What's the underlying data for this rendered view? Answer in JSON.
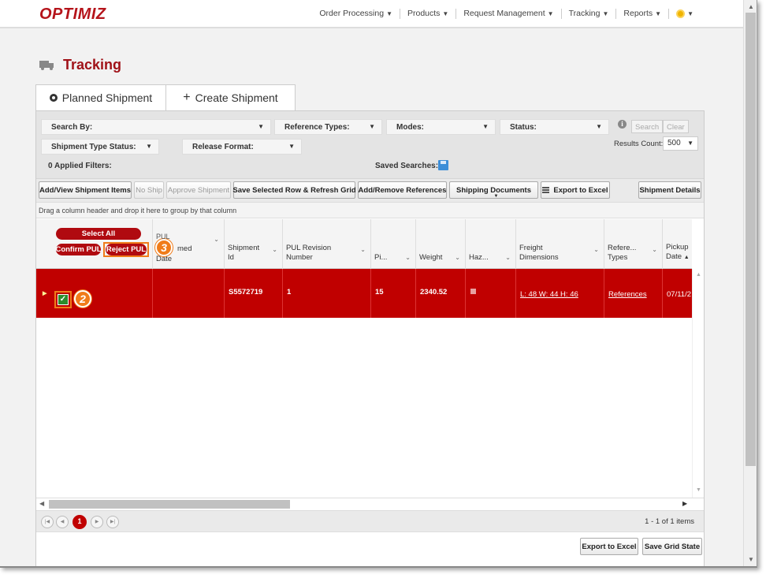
{
  "app": {
    "logo": "OPTIMIZ"
  },
  "nav": [
    {
      "label": "Order Processing"
    },
    {
      "label": "Products"
    },
    {
      "label": "Request Management"
    },
    {
      "label": "Tracking"
    },
    {
      "label": "Reports"
    }
  ],
  "page": {
    "title": "Tracking"
  },
  "tabs": {
    "planned": "Planned Shipment",
    "create": "Create Shipment"
  },
  "filters": {
    "search_by": "Search By:",
    "reference_types": "Reference Types:",
    "modes": "Modes:",
    "status": "Status:",
    "shipment_type_status": "Shipment Type Status:",
    "release_format": "Release Format:",
    "search_btn": "Search",
    "clear_btn": "Clear",
    "results_count_label": "Results Count:",
    "results_count_value": "500",
    "applied_filters": "0 Applied Filters:",
    "saved_searches": "Saved Searches:"
  },
  "toolbar": {
    "add_view": "Add/View Shipment Items",
    "no_ship": "No Ship",
    "approve": "Approve Shipment",
    "save_refresh": "Save Selected Row & Refresh Grid",
    "add_remove_refs": "Add/Remove References",
    "shipping_docs": "Shipping Documents",
    "export_excel": "Export to Excel",
    "shipment_details": "Shipment Details"
  },
  "group_hint": "Drag a column header and drop it here to group by that column",
  "grid": {
    "select_all": "Select All",
    "confirm_pul": "Confirm PUL",
    "reject_pul": "Reject PUL",
    "columns": {
      "pul_confirmed_date_1": "PUL",
      "pul_confirmed_date_2": "med",
      "pul_confirmed_date_3": "Date",
      "shipment_id_1": "Shipment",
      "shipment_id_2": "Id",
      "pul_revision_1": "PUL Revision",
      "pul_revision_2": "Number",
      "pieces": "Pi...",
      "weight": "Weight",
      "hazmat": "Haz...",
      "freight_1": "Freight",
      "freight_2": "Dimensions",
      "ref_types_1": "Refere...",
      "ref_types_2": "Types",
      "pickup_1": "Pickup",
      "pickup_2": "Date"
    },
    "rows": [
      {
        "shipment_id": "S5572719",
        "pul_revision": "1",
        "pieces": "15",
        "weight": "2340.52",
        "freight_dimensions": "L: 48 W: 44 H: 46",
        "references": "References",
        "pickup_date": "07/11/2"
      }
    ]
  },
  "badges": {
    "step2": "2",
    "step3": "3"
  },
  "pager": {
    "current_page": "1",
    "info": "1 - 1 of 1 items"
  },
  "footer": {
    "export_excel": "Export to Excel",
    "save_grid_state": "Save Grid State"
  },
  "colors": {
    "brand_red": "#c00000",
    "highlight_orange": "#f07c1a"
  }
}
